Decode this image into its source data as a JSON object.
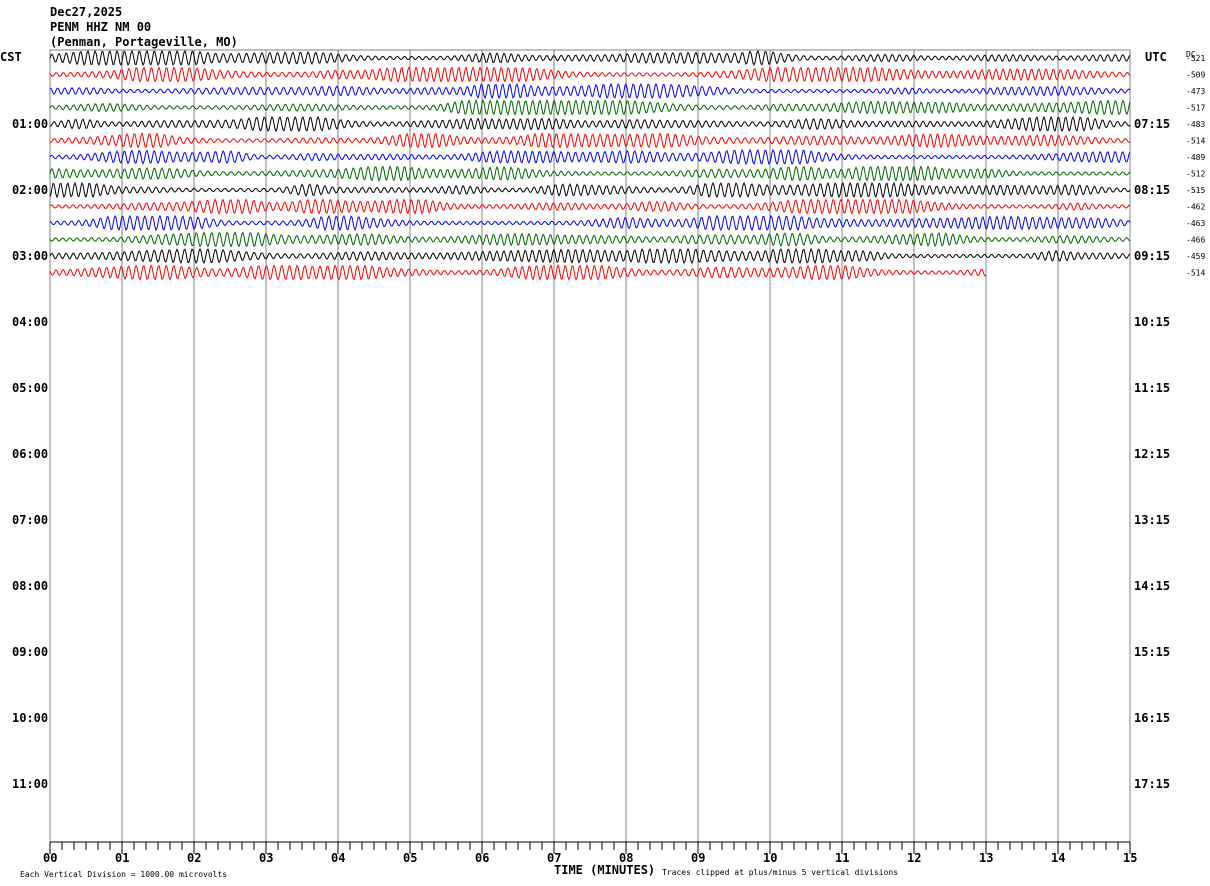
{
  "header": {
    "date": "Dec27,2025",
    "station": "PENM HHZ NM 00",
    "location": "(Penman, Portageville, MO)"
  },
  "left_tz": "CST",
  "right_tz": "UTC",
  "dc_label": "DC",
  "footer": {
    "scale": "Each Vertical Division = 1000.00 microvolts",
    "xlabel": "TIME (MINUTES)",
    "clip": "Traces clipped at plus/minus 5 vertical divisions"
  },
  "chart_data": {
    "type": "line",
    "xlabel": "TIME (MINUTES)",
    "xlim": [
      0,
      15
    ],
    "x_ticks": [
      "00",
      "01",
      "02",
      "03",
      "04",
      "05",
      "06",
      "07",
      "08",
      "09",
      "10",
      "11",
      "12",
      "13",
      "14",
      "15"
    ],
    "left_hour_labels": [
      "01:00",
      "02:00",
      "03:00",
      "04:00",
      "05:00",
      "06:00",
      "07:00",
      "08:00",
      "09:00",
      "10:00",
      "11:00"
    ],
    "right_hour_labels": [
      "07:15",
      "08:15",
      "09:15",
      "10:15",
      "11:15",
      "12:15",
      "13:15",
      "14:15",
      "15:15",
      "16:15",
      "17:15"
    ],
    "trace_colors": [
      "#000000",
      "#ff0000",
      "#0000ff",
      "#006400"
    ],
    "dc_offsets": [
      "-521",
      "-509",
      "-473",
      "-517",
      "-483",
      "-514",
      "-489",
      "-512",
      "-515",
      "-462",
      "-463",
      "-466",
      "-459",
      "-514"
    ],
    "last_trace_end_minute": 13,
    "grid": true
  }
}
